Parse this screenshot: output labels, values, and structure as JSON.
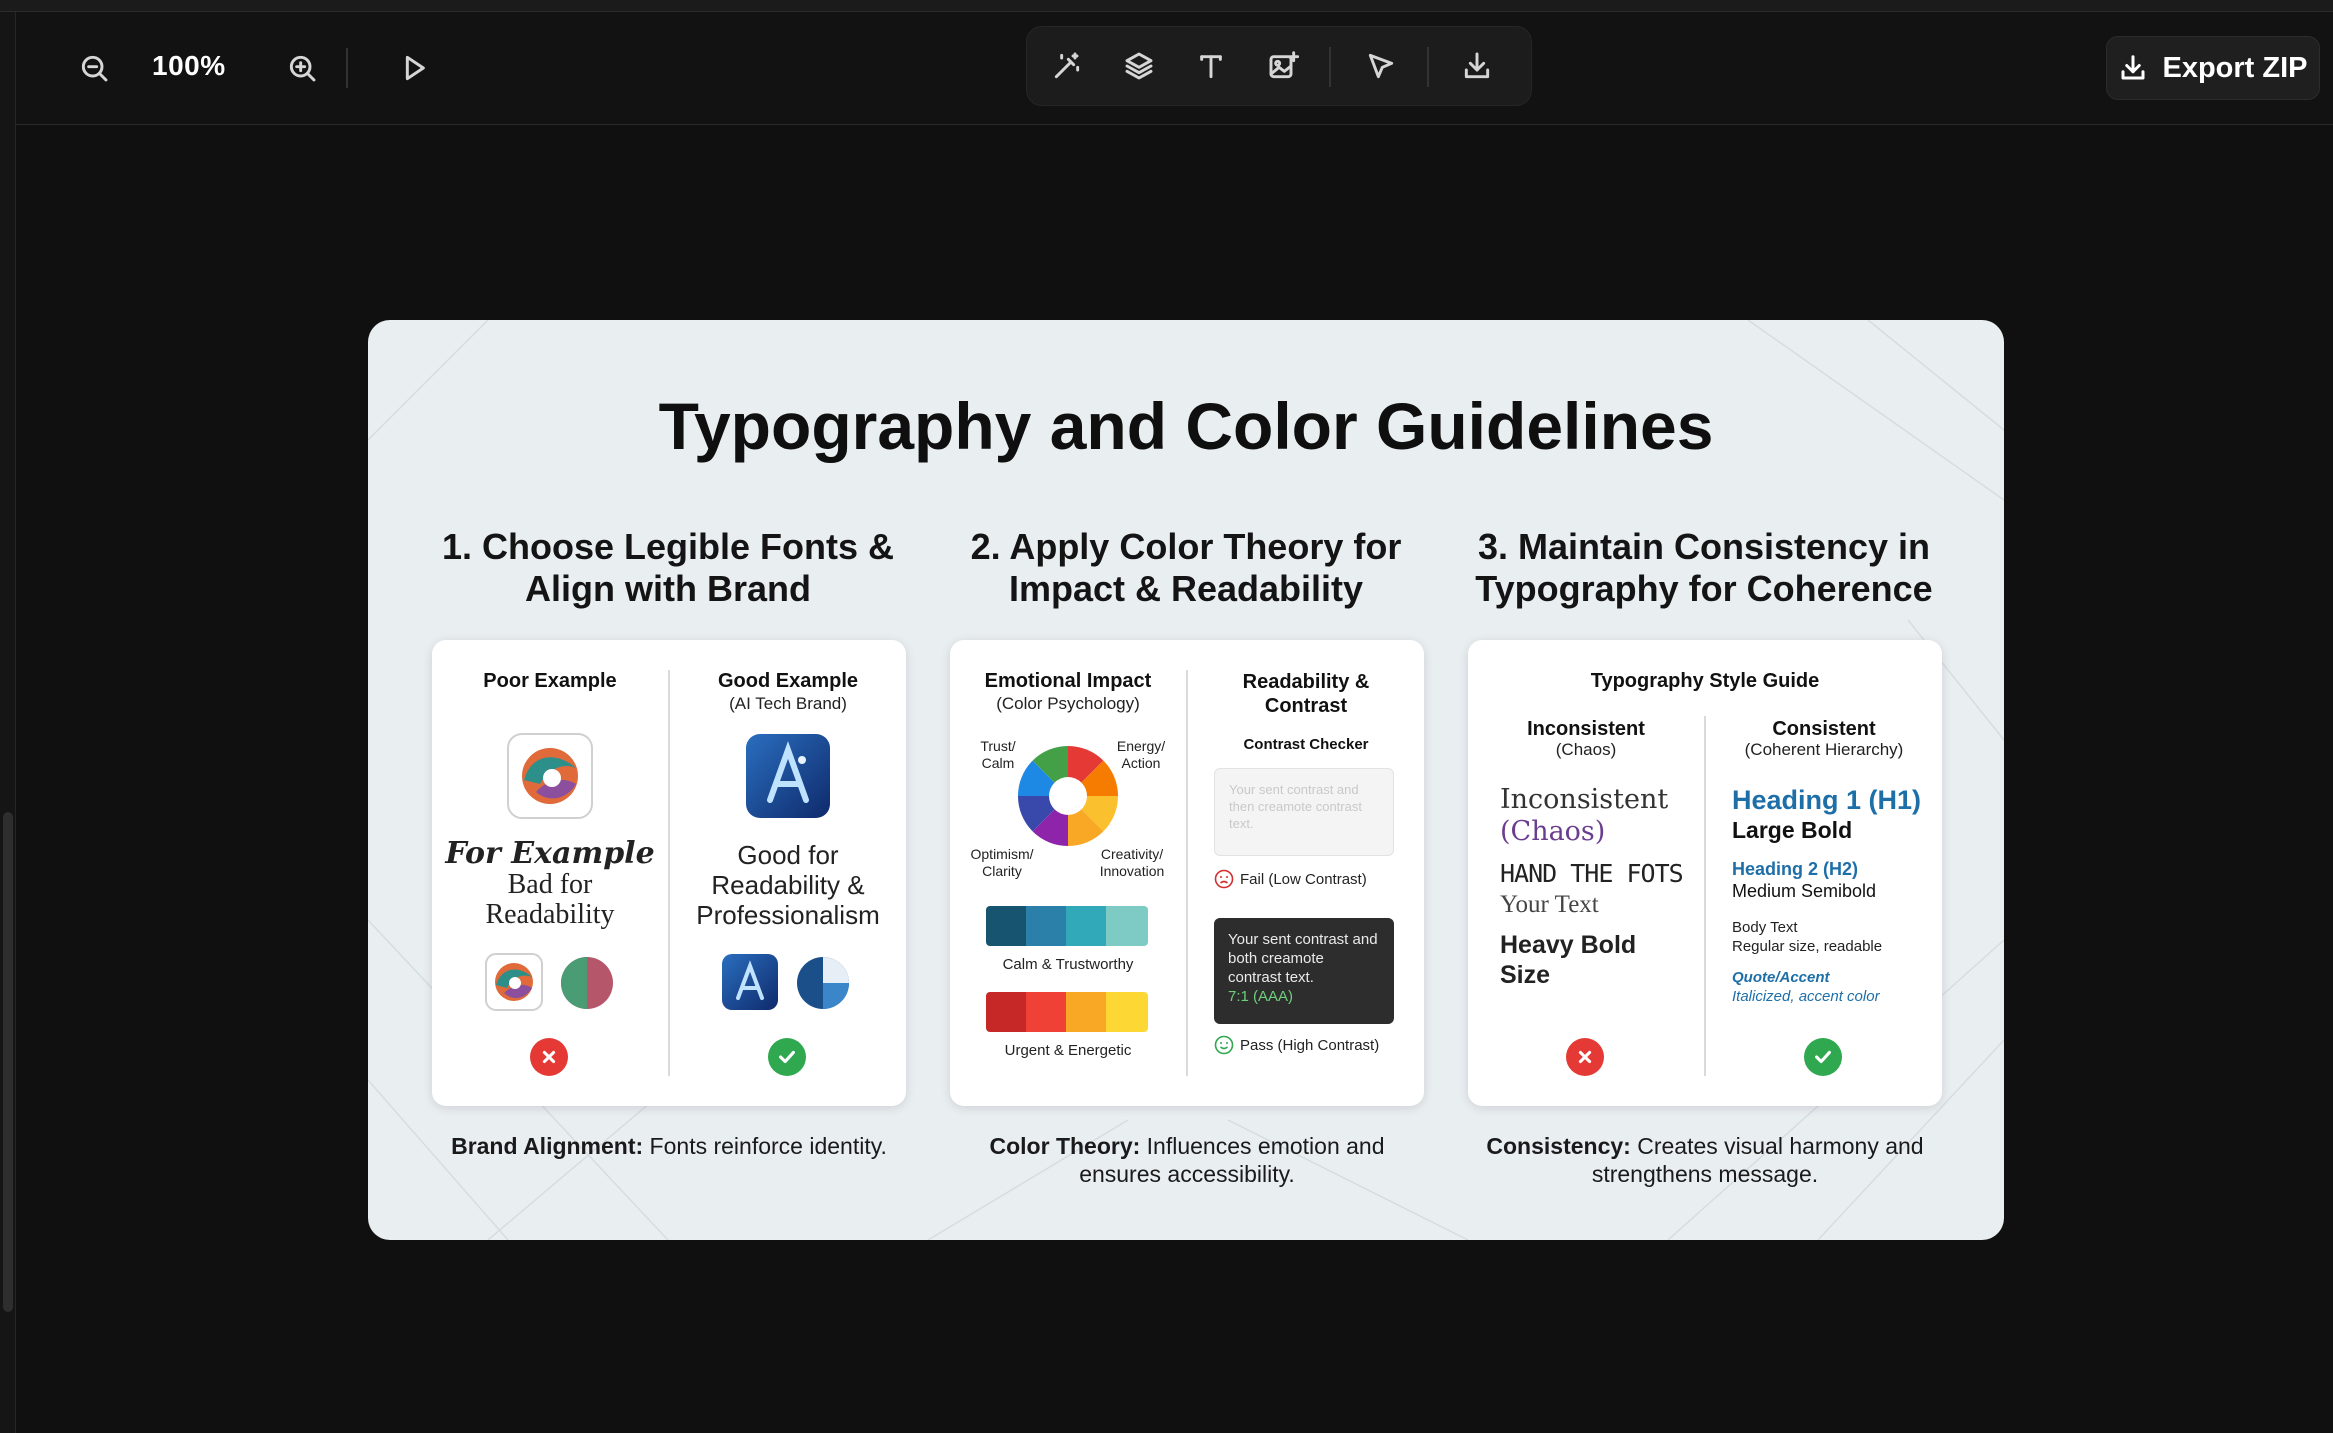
{
  "toolbar": {
    "zoom_level": "100%",
    "export_label": "Export ZIP"
  },
  "slide": {
    "title": "Typography and Color Guidelines",
    "col1": {
      "heading_line1": "1. Choose Legible Fonts &",
      "heading_line2": "Align with Brand",
      "poor_label": "Poor Example",
      "good_label": "Good Example",
      "good_sub": "(AI Tech Brand)",
      "poor_script": "For Example",
      "poor_text_line1": "Bad for",
      "poor_text_line2": "Readability",
      "good_text_line1": "Good for",
      "good_text_line2": "Readability &",
      "good_text_line3": "Professionalism",
      "caption_bold": "Brand Alignment:",
      "caption_rest": " Fonts reinforce identity."
    },
    "col2": {
      "heading_line1": "2. Apply Color Theory for",
      "heading_line2": "Impact & Readability",
      "emotional_label": "Emotional Impact",
      "emotional_sub": "(Color Psychology)",
      "trust_label": "Trust/ Calm",
      "energy_label": "Energy/ Action",
      "optimism_label": "Optimism/ Clarity",
      "creativity_label": "Creativity/ Innovation",
      "calm_label": "Calm & Trustworthy",
      "urgent_label": "Urgent & Energetic",
      "readability_label": "Readability &",
      "readability_label2": "Contrast",
      "checker_label": "Contrast Checker",
      "low_text": "Your sent contrast and then creamote contrast text.",
      "fail_label": "Fail (Low Contrast)",
      "high_text": "Your sent contrast and both creamote contrast text.",
      "ratio_text": "7:1 (AAA)",
      "pass_label": "Pass (High Contrast)",
      "caption_bold": "Color Theory:",
      "caption_rest": " Influences emotion and",
      "caption_line2": "ensures accessibility."
    },
    "col3": {
      "heading_line1": "3. Maintain Consistency in",
      "heading_line2": "Typography for Coherence",
      "guide_label": "Typography Style Guide",
      "inconsistent_label": "Inconsistent",
      "inconsistent_sub": "(Chaos)",
      "consistent_label": "Consistent",
      "consistent_sub": "(Coherent Hierarchy)",
      "inc_line1": "Inconsistent",
      "inc_line2": "(Chaos)",
      "inc_line3": "HAND THE FOTS",
      "inc_line4": "Your Text",
      "inc_line5": "Heavy Bold",
      "inc_line6": "Size",
      "h1_text": "Heading 1 (H1)",
      "h1_desc": "Large Bold",
      "h2_text": "Heading 2 (H2)",
      "h2_desc": "Medium Semibold",
      "body_text": "Body Text",
      "body_desc": "Regular size, readable",
      "quote_text": "Quote/Accent",
      "quote_desc": "Italicized, accent color",
      "caption_bold": "Consistency:",
      "caption_rest": " Creates visual harmony and",
      "caption_line2": "strengthens message."
    }
  },
  "colors": {
    "accent_blue": "#1e6fa8",
    "bad_red": "#e53935",
    "good_green": "#2fa84f"
  },
  "icons": [
    "zoom-out-icon",
    "zoom-in-icon",
    "play-icon",
    "magic-wand-icon",
    "layers-icon",
    "text-icon",
    "image-add-icon",
    "pointer-icon",
    "download-icon"
  ]
}
